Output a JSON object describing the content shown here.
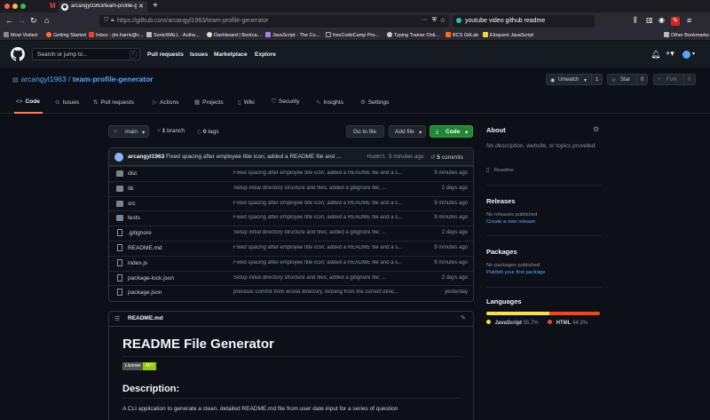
{
  "browser": {
    "tab_title": "arcangyl1963/team-profile-ge",
    "url": "https://github.com/arcangyl1963/team-profile-generator",
    "search": "youtube video github readme",
    "bookmarks": [
      "Most Visited",
      "Getting Started",
      "Inbox - jim.harris@c...",
      "SonicWALL - Authe...",
      "Dashboard | Bootca...",
      "JavaScript - The Co...",
      "freeCodeCamp Pro...",
      "Typing Trainer Onli...",
      "BCS GitLab",
      "Eloquent JavaScript"
    ],
    "other_bookmarks": "Other Bookmarks"
  },
  "colors": {
    "accent": "#58a6ff",
    "green": "#238636",
    "tab_underline": "#f78166",
    "js": "#f1e05a",
    "html": "#e34c26"
  },
  "gh": {
    "search_placeholder": "Search or jump to...",
    "slash": "/",
    "nav": [
      "Pull requests",
      "Issues",
      "Marketplace",
      "Explore"
    ]
  },
  "repo": {
    "owner": "arcangyl1963",
    "sep": " / ",
    "name": "team-profile-generator",
    "unwatch": "Unwatch",
    "unwatch_count": "1",
    "star": "Star",
    "star_count": "0",
    "fork": "Fork",
    "fork_count": "0",
    "tabs": [
      "Code",
      "Issues",
      "Pull requests",
      "Actions",
      "Projects",
      "Wiki",
      "Security",
      "Insights",
      "Settings"
    ]
  },
  "filenav": {
    "branch": "main",
    "branch_count": "1",
    "branch_label": "branch",
    "tag_count": "0",
    "tag_label": "tags",
    "go_to_file": "Go to file",
    "add_file": "Add file",
    "code": "Code"
  },
  "commit": {
    "author": "arcangyl1963",
    "message": "Fixed spacing after employee title icon; added a README file and ...",
    "sha": "f5a0671",
    "time": "9 minutes ago",
    "count": "5",
    "label": "commits"
  },
  "files": [
    {
      "type": "dir",
      "name": "dist",
      "msg": "Fixed spacing after employee title icon; added a README file and a s...",
      "time": "9 minutes ago"
    },
    {
      "type": "dir",
      "name": "lib",
      "msg": "Setup initial directory structure and files; added a gitignore file; ...",
      "time": "2 days ago"
    },
    {
      "type": "dir",
      "name": "src",
      "msg": "Fixed spacing after employee title icon; added a README file and a s...",
      "time": "9 minutes ago"
    },
    {
      "type": "dir",
      "name": "tests",
      "msg": "Fixed spacing after employee title icon; added a README file and a s...",
      "time": "9 minutes ago"
    },
    {
      "type": "file",
      "name": ".gitignore",
      "msg": "Setup initial directory structure and files; added a gitignore file; ...",
      "time": "2 days ago"
    },
    {
      "type": "file",
      "name": "README.md",
      "msg": "Fixed spacing after employee title icon; added a README file and a s...",
      "time": "9 minutes ago"
    },
    {
      "type": "file",
      "name": "index.js",
      "msg": "Fixed spacing after employee title icon; added a README file and a s...",
      "time": "9 minutes ago"
    },
    {
      "type": "file",
      "name": "package-lock.json",
      "msg": "Setup initial directory structure and files; added a gitignore file; ...",
      "time": "2 days ago"
    },
    {
      "type": "file",
      "name": "package.json",
      "msg": "previous commit from wrond directory, redoing from the correct direc...",
      "time": "yesterday"
    }
  ],
  "readme": {
    "file": "README.md",
    "title": "README File Generator",
    "badge_left": "License",
    "badge_right": "MIT",
    "desc_heading": "Description:",
    "desc_text": "A CLI application to generate a clean, detailed README.md file from user date input for a series of question"
  },
  "sidebar": {
    "about": "About",
    "about_text": "No description, website, or topics provided.",
    "readme": "Readme",
    "releases": "Releases",
    "no_releases": "No releases published",
    "create_release": "Create a new release",
    "packages": "Packages",
    "no_packages": "No packages published",
    "publish_package": "Publish your first package",
    "languages": "Languages",
    "langs": [
      {
        "name": "JavaScript",
        "pct": "55.7%",
        "value": 55.7
      },
      {
        "name": "HTML",
        "pct": "44.3%",
        "value": 44.3
      }
    ]
  }
}
